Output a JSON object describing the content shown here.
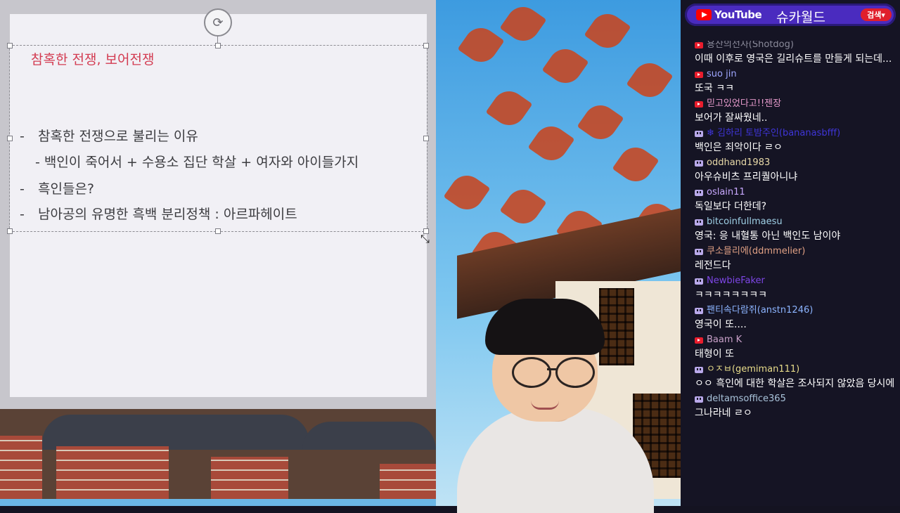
{
  "slide": {
    "title": "참혹한 전쟁, 보어전쟁",
    "bullets": [
      {
        "dash": "-",
        "text": "참혹한 전쟁으로 불리는 이유"
      },
      {
        "dash": "",
        "text": "- 백인이 죽어서 + 수용소 집단 학살 + 여자와 아이들가지"
      },
      {
        "dash": "-",
        "text": "흑인들은?"
      },
      {
        "dash": "-",
        "text": "남아공의 유명한 흑백 분리정책 : 아르파헤이트"
      }
    ]
  },
  "chat": {
    "brand": "YouTube",
    "channel": "슈카월드",
    "search_label": "검색",
    "messages": [
      {
        "platform": "youtube",
        "user": "용산의선사(Shotdog)",
        "user_color": "#8a8a9a",
        "text": "이때 이후로 영국은 길리슈트를 만들게 되는데..."
      },
      {
        "platform": "youtube",
        "user": "suo jin",
        "user_color": "#9fa6ff",
        "text": "또국 ㅋㅋ"
      },
      {
        "platform": "youtube",
        "user": "믿고있었다고!!젠장",
        "user_color": "#e59acb",
        "text": "보어가 잘싸웠네.."
      },
      {
        "platform": "twitch",
        "user": "❄ 김하리 토밤주인(bananasbfff)",
        "user_color": "#3f35d8",
        "text": "백인은 죄악이다 ㄹㅇ"
      },
      {
        "platform": "twitch",
        "user": "oddhand1983",
        "user_color": "#e8d9a8",
        "text": "아우슈비츠 프리퀄아니냐"
      },
      {
        "platform": "twitch",
        "user": "oslain11",
        "user_color": "#c8a8ff",
        "text": "독일보다 더한데?"
      },
      {
        "platform": "twitch",
        "user": "bitcoinfullmaesu",
        "user_color": "#9fd0e6",
        "text": "영국: 응 내혈통 아닌 백인도 남이야"
      },
      {
        "platform": "twitch",
        "user": "쿠소믈리에(ddmmelier)",
        "user_color": "#e0a084",
        "text": "레전드다"
      },
      {
        "platform": "twitch",
        "user": "NewbieFaker",
        "user_color": "#7d46e6",
        "text": "ㅋㅋㅋㅋㅋㅋㅋㅋ"
      },
      {
        "platform": "twitch",
        "user": "팬티속다람쥐(anstn1246)",
        "user_color": "#8cb4ff",
        "text": "영국이 또...."
      },
      {
        "platform": "youtube",
        "user": "Baam K",
        "user_color": "#c8a0c8",
        "text": "태형이 또"
      },
      {
        "platform": "twitch",
        "user": "ㅇㅈㅂ(gemiman111)",
        "user_color": "#e8dc8a",
        "text": "ㅇㅇ 흑인에 대한 학살은 조사되지 않았음 당시에"
      },
      {
        "platform": "twitch",
        "user": "deltamsoffice365",
        "user_color": "#a9c3da",
        "text": "그나라네 ㄹㅇ"
      }
    ]
  }
}
